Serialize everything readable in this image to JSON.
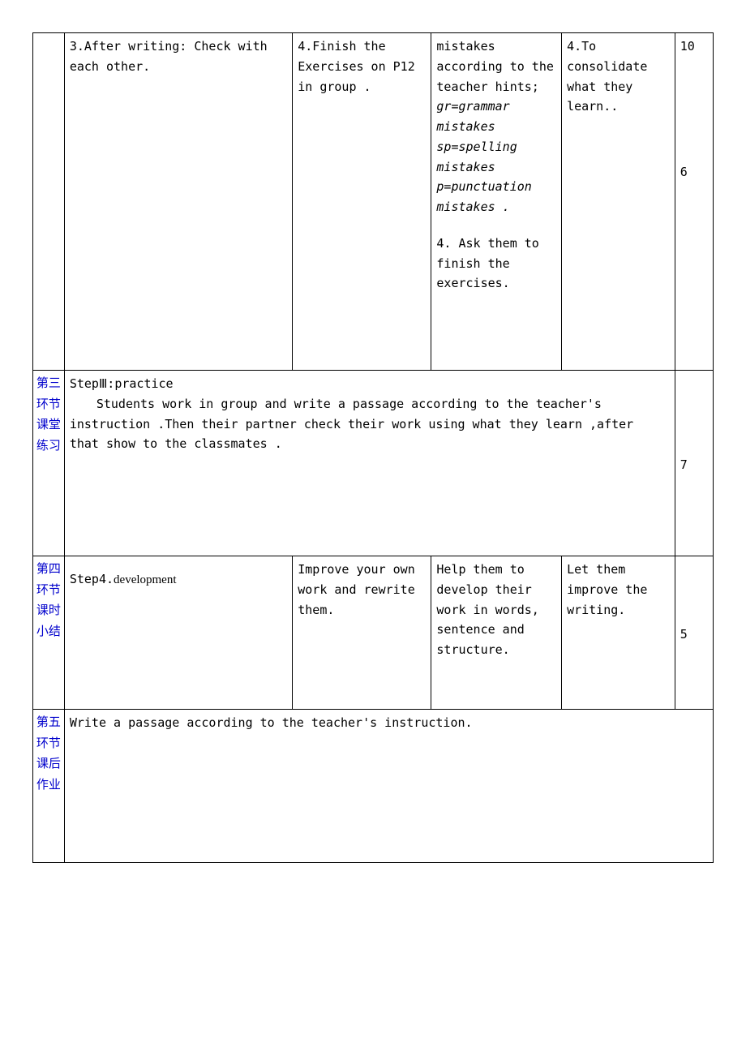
{
  "row2": {
    "label": "",
    "main_bottom": "3.After writing: Check with each other.",
    "b_bottom": "4.Finish the Exercises on P12 in group .",
    "c_top_lines": [
      "mistakes according to the teacher hints;",
      "gr=grammar mistakes",
      "sp=spelling mistakes",
      "p=punctuation mistakes ."
    ],
    "c_bottom": "4. Ask them to finish the exercises.",
    "d_bottom": "4.To consolidate what they learn..",
    "time_top": "10",
    "time_mid": "6"
  },
  "row3": {
    "label": "第三环节课堂练习",
    "heading": "StepⅢ:practice",
    "body": "Students work in group and write a passage according to the teacher's instruction .Then their partner check their work using what they learn ,after that show to the classmates .",
    "time": "7"
  },
  "row4": {
    "label": "第四环节课时小结",
    "main": "Step4.",
    "main_suffix": "development",
    "b": "Improve your own work and rewrite them.",
    "c": "Help them to develop their work in words, sentence and structure.",
    "d": "Let them improve the writing.",
    "time": "5"
  },
  "row5": {
    "label": "第五环节课后作业",
    "body": "Write a passage according to the teacher's instruction."
  }
}
